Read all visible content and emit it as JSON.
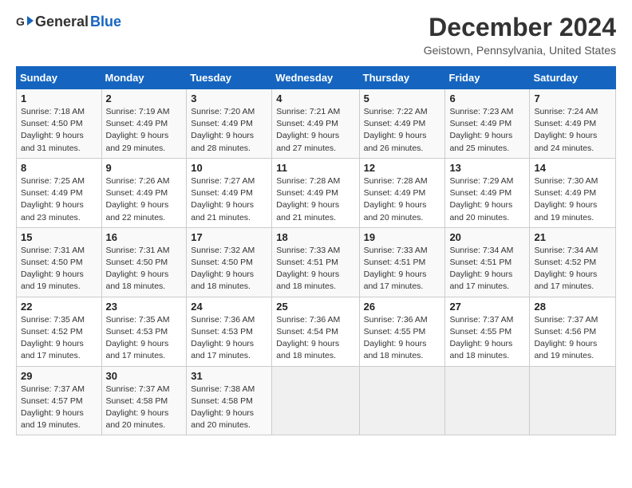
{
  "header": {
    "logo_general": "General",
    "logo_blue": "Blue",
    "month": "December 2024",
    "location": "Geistown, Pennsylvania, United States"
  },
  "weekdays": [
    "Sunday",
    "Monday",
    "Tuesday",
    "Wednesday",
    "Thursday",
    "Friday",
    "Saturday"
  ],
  "weeks": [
    [
      {
        "day": "1",
        "sunrise": "7:18 AM",
        "sunset": "4:50 PM",
        "daylight": "9 hours and 31 minutes."
      },
      {
        "day": "2",
        "sunrise": "7:19 AM",
        "sunset": "4:49 PM",
        "daylight": "9 hours and 29 minutes."
      },
      {
        "day": "3",
        "sunrise": "7:20 AM",
        "sunset": "4:49 PM",
        "daylight": "9 hours and 28 minutes."
      },
      {
        "day": "4",
        "sunrise": "7:21 AM",
        "sunset": "4:49 PM",
        "daylight": "9 hours and 27 minutes."
      },
      {
        "day": "5",
        "sunrise": "7:22 AM",
        "sunset": "4:49 PM",
        "daylight": "9 hours and 26 minutes."
      },
      {
        "day": "6",
        "sunrise": "7:23 AM",
        "sunset": "4:49 PM",
        "daylight": "9 hours and 25 minutes."
      },
      {
        "day": "7",
        "sunrise": "7:24 AM",
        "sunset": "4:49 PM",
        "daylight": "9 hours and 24 minutes."
      }
    ],
    [
      {
        "day": "8",
        "sunrise": "7:25 AM",
        "sunset": "4:49 PM",
        "daylight": "9 hours and 23 minutes."
      },
      {
        "day": "9",
        "sunrise": "7:26 AM",
        "sunset": "4:49 PM",
        "daylight": "9 hours and 22 minutes."
      },
      {
        "day": "10",
        "sunrise": "7:27 AM",
        "sunset": "4:49 PM",
        "daylight": "9 hours and 21 minutes."
      },
      {
        "day": "11",
        "sunrise": "7:28 AM",
        "sunset": "4:49 PM",
        "daylight": "9 hours and 21 minutes."
      },
      {
        "day": "12",
        "sunrise": "7:28 AM",
        "sunset": "4:49 PM",
        "daylight": "9 hours and 20 minutes."
      },
      {
        "day": "13",
        "sunrise": "7:29 AM",
        "sunset": "4:49 PM",
        "daylight": "9 hours and 20 minutes."
      },
      {
        "day": "14",
        "sunrise": "7:30 AM",
        "sunset": "4:49 PM",
        "daylight": "9 hours and 19 minutes."
      }
    ],
    [
      {
        "day": "15",
        "sunrise": "7:31 AM",
        "sunset": "4:50 PM",
        "daylight": "9 hours and 19 minutes."
      },
      {
        "day": "16",
        "sunrise": "7:31 AM",
        "sunset": "4:50 PM",
        "daylight": "9 hours and 18 minutes."
      },
      {
        "day": "17",
        "sunrise": "7:32 AM",
        "sunset": "4:50 PM",
        "daylight": "9 hours and 18 minutes."
      },
      {
        "day": "18",
        "sunrise": "7:33 AM",
        "sunset": "4:51 PM",
        "daylight": "9 hours and 18 minutes."
      },
      {
        "day": "19",
        "sunrise": "7:33 AM",
        "sunset": "4:51 PM",
        "daylight": "9 hours and 17 minutes."
      },
      {
        "day": "20",
        "sunrise": "7:34 AM",
        "sunset": "4:51 PM",
        "daylight": "9 hours and 17 minutes."
      },
      {
        "day": "21",
        "sunrise": "7:34 AM",
        "sunset": "4:52 PM",
        "daylight": "9 hours and 17 minutes."
      }
    ],
    [
      {
        "day": "22",
        "sunrise": "7:35 AM",
        "sunset": "4:52 PM",
        "daylight": "9 hours and 17 minutes."
      },
      {
        "day": "23",
        "sunrise": "7:35 AM",
        "sunset": "4:53 PM",
        "daylight": "9 hours and 17 minutes."
      },
      {
        "day": "24",
        "sunrise": "7:36 AM",
        "sunset": "4:53 PM",
        "daylight": "9 hours and 17 minutes."
      },
      {
        "day": "25",
        "sunrise": "7:36 AM",
        "sunset": "4:54 PM",
        "daylight": "9 hours and 18 minutes."
      },
      {
        "day": "26",
        "sunrise": "7:36 AM",
        "sunset": "4:55 PM",
        "daylight": "9 hours and 18 minutes."
      },
      {
        "day": "27",
        "sunrise": "7:37 AM",
        "sunset": "4:55 PM",
        "daylight": "9 hours and 18 minutes."
      },
      {
        "day": "28",
        "sunrise": "7:37 AM",
        "sunset": "4:56 PM",
        "daylight": "9 hours and 19 minutes."
      }
    ],
    [
      {
        "day": "29",
        "sunrise": "7:37 AM",
        "sunset": "4:57 PM",
        "daylight": "9 hours and 19 minutes."
      },
      {
        "day": "30",
        "sunrise": "7:37 AM",
        "sunset": "4:58 PM",
        "daylight": "9 hours and 20 minutes."
      },
      {
        "day": "31",
        "sunrise": "7:38 AM",
        "sunset": "4:58 PM",
        "daylight": "9 hours and 20 minutes."
      },
      null,
      null,
      null,
      null
    ]
  ]
}
